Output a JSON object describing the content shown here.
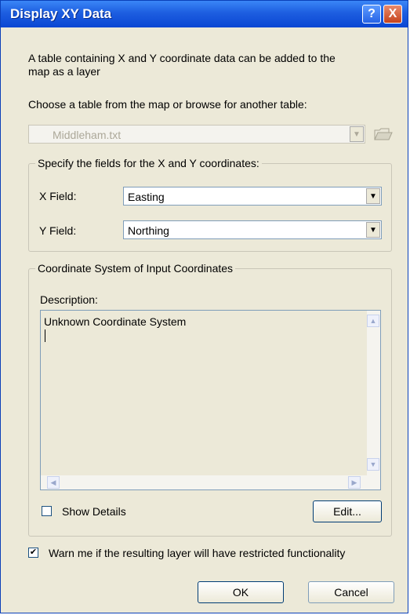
{
  "window": {
    "title": "Display XY Data",
    "help_icon": "?",
    "close_icon": "X"
  },
  "intro": {
    "line1": "A table containing X and Y coordinate data can be added to the",
    "line2": "map as a layer"
  },
  "table": {
    "label": "Choose a table from the map or browse for another table:",
    "value": "Middleham.txt",
    "browse_icon": "open-folder-icon"
  },
  "fields": {
    "group_label": "Specify the fields for the X and Y coordinates:",
    "x_label": "X Field:",
    "x_value": "Easting",
    "y_label": "Y Field:",
    "y_value": "Northing"
  },
  "coords": {
    "group_label": "Coordinate System of Input Coordinates",
    "description_label": "Description:",
    "description_text": "Unknown Coordinate System",
    "show_details_label": "Show Details",
    "show_details_checked": false,
    "edit_label": "Edit..."
  },
  "warn": {
    "label": "Warn me if the resulting layer will have restricted functionality",
    "checked": true
  },
  "buttons": {
    "ok": "OK",
    "cancel": "Cancel"
  },
  "colors": {
    "titlebar": "#0a46d3",
    "dialog_bg": "#ece9d8"
  }
}
